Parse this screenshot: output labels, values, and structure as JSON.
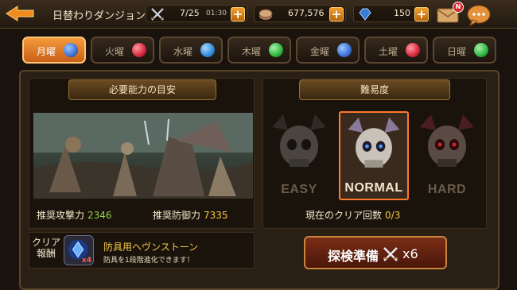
{
  "header": {
    "title": "日替わりダンジョン",
    "stamina": {
      "value": "7/25",
      "timer": "01:30"
    },
    "gold": "677,576",
    "gems": "150",
    "mail_badge": "N"
  },
  "days": [
    {
      "label": "月曜",
      "gem_color": "#3b73d6",
      "active": true
    },
    {
      "label": "火曜",
      "gem_color": "#d6283b",
      "active": false
    },
    {
      "label": "水曜",
      "gem_color": "#2f8ad9",
      "active": false
    },
    {
      "label": "木曜",
      "gem_color": "#2fb53f",
      "active": false
    },
    {
      "label": "金曜",
      "gem_color": "#3b73d6",
      "active": false
    },
    {
      "label": "土曜",
      "gem_color": "#d6283b",
      "active": false
    },
    {
      "label": "日曜",
      "gem_color": "#2fb53f",
      "active": false
    }
  ],
  "requirements": {
    "header": "必要能力の目安",
    "attack_label": "推奨攻撃力",
    "attack_value": "2346",
    "defense_label": "推奨防御力",
    "defense_value": "7335"
  },
  "difficulty": {
    "header": "難易度",
    "levels": [
      "EASY",
      "NORMAL",
      "HARD"
    ],
    "selected": "NORMAL",
    "clear_label": "現在のクリア回数",
    "clear_value": "0/3"
  },
  "reward": {
    "label_line1": "クリア",
    "label_line2": "報酬",
    "item_count": "x4",
    "title": "防具用ヘヴンストーン",
    "description": "防具を1段階進化できます！"
  },
  "action": {
    "label": "探検準備",
    "cost": "x6"
  }
}
